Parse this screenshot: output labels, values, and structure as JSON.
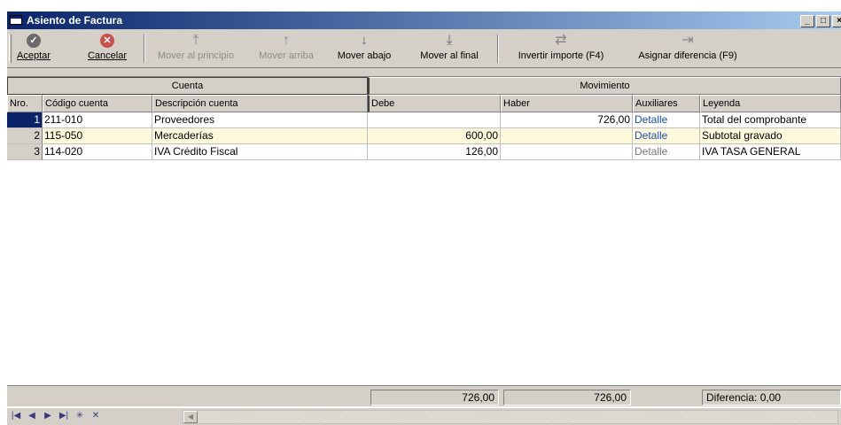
{
  "window": {
    "title": "Asiento de Factura",
    "controls": {
      "minimize": "_",
      "maximize": "□",
      "close": "×"
    }
  },
  "toolbar": {
    "accept": "Aceptar",
    "cancel": "Cancelar",
    "move_first": "Mover al principio",
    "move_up": "Mover arriba",
    "move_down": "Mover abajo",
    "move_last": "Mover al final",
    "invert": "Invertir importe (F4)",
    "assign": "Asignar diferencia (F9)"
  },
  "icons": {
    "accept": "check-icon",
    "cancel": "x-circle-icon",
    "move_first": "move-first-icon",
    "move_up": "move-up-icon",
    "move_down": "move-down-icon",
    "move_last": "move-last-icon",
    "invert": "invert-icon",
    "assign": "assign-icon"
  },
  "grid": {
    "group_headers": {
      "cuenta": "Cuenta",
      "movimiento": "Movimiento"
    },
    "columns": {
      "nro": "Nro.",
      "codigo": "Código cuenta",
      "descripcion": "Descripción cuenta",
      "debe": "Debe",
      "haber": "Haber",
      "auxiliares": "Auxiliares",
      "leyenda": "Leyenda"
    },
    "rows": [
      {
        "nro": "1",
        "codigo": "211-010",
        "descripcion": "Proveedores",
        "debe": "",
        "haber": "726,00",
        "auxiliares": "Detalle",
        "leyenda": "Total del comprobante"
      },
      {
        "nro": "2",
        "codigo": "115-050",
        "descripcion": "Mercaderías",
        "debe": "600,00",
        "haber": "",
        "auxiliares": "Detalle",
        "leyenda": "Subtotal gravado"
      },
      {
        "nro": "3",
        "codigo": "114-020",
        "descripcion": "IVA Crédito Fiscal",
        "debe": "126,00",
        "haber": "",
        "auxiliares": "Detalle",
        "leyenda": "IVA TASA GENERAL"
      }
    ]
  },
  "totals": {
    "debe": "726,00",
    "haber": "726,00",
    "diferencia": "Diferencia: 0,00"
  },
  "navigator": {
    "first": "|◀",
    "prior": "◀",
    "next": "▶",
    "last": "▶|",
    "insert": "✳",
    "delete": "✕",
    "scroll_left": "◀"
  },
  "colors": {
    "title_start": "#0a246a",
    "title_end": "#a6caf0",
    "selected_row": "#fff9dc",
    "link": "#1a4fb0"
  }
}
